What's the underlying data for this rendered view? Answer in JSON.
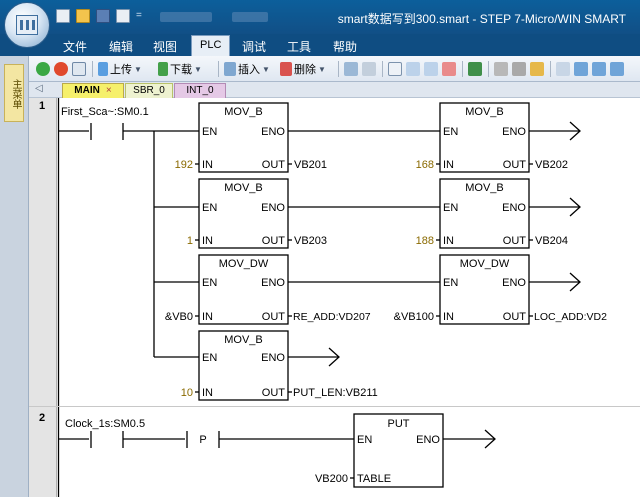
{
  "titlebar": {
    "title": "smart数据写到300.smart - STEP 7-Micro/WIN SMART",
    "qat_drop": "="
  },
  "menu": {
    "items": [
      "文件",
      "编辑",
      "视图",
      "PLC",
      "调试",
      "工具",
      "帮助"
    ],
    "active": "PLC"
  },
  "toolbar": {
    "upload": "上传",
    "download": "下载",
    "insert": "插入",
    "delete": "删除"
  },
  "left_panel": {
    "label": "主菜单"
  },
  "tabs": [
    {
      "label": "MAIN",
      "close": "×"
    },
    {
      "label": "SBR_0"
    },
    {
      "label": "INT_0"
    }
  ],
  "tabs_arrow": "◁",
  "networks": [
    {
      "number": "1",
      "contact_label": "First_Sca~:SM0.1",
      "blocks": [
        {
          "name": "MOV_B",
          "en": "EN",
          "eno": "ENO",
          "in_pin": "IN",
          "out_pin": "OUT",
          "in_value": "192",
          "out_value": "VB201"
        },
        {
          "name": "MOV_B",
          "en": "EN",
          "eno": "ENO",
          "in_pin": "IN",
          "out_pin": "OUT",
          "in_value": "168",
          "out_value": "VB202"
        },
        {
          "name": "MOV_B",
          "en": "EN",
          "eno": "ENO",
          "in_pin": "IN",
          "out_pin": "OUT",
          "in_value": "1",
          "out_value": "VB203"
        },
        {
          "name": "MOV_B",
          "en": "EN",
          "eno": "ENO",
          "in_pin": "IN",
          "out_pin": "OUT",
          "in_value": "188",
          "out_value": "VB204"
        },
        {
          "name": "MOV_DW",
          "en": "EN",
          "eno": "ENO",
          "in_pin": "IN",
          "out_pin": "OUT",
          "in_value": "&VB0",
          "out_value": "RE_ADD:VD207"
        },
        {
          "name": "MOV_DW",
          "en": "EN",
          "eno": "ENO",
          "in_pin": "IN",
          "out_pin": "OUT",
          "in_value": "&VB100",
          "out_value": "LOC_ADD:VD2"
        },
        {
          "name": "MOV_B",
          "en": "EN",
          "eno": "ENO",
          "in_pin": "IN",
          "out_pin": "OUT",
          "in_value": "10",
          "out_value": "PUT_LEN:VB211"
        }
      ]
    },
    {
      "number": "2",
      "contact_label": "Clock_1s:SM0.5",
      "pulse_label": "P",
      "block": {
        "name": "PUT",
        "en": "EN",
        "eno": "ENO",
        "table_pin": "TABLE",
        "table_value": "VB200"
      }
    }
  ]
}
